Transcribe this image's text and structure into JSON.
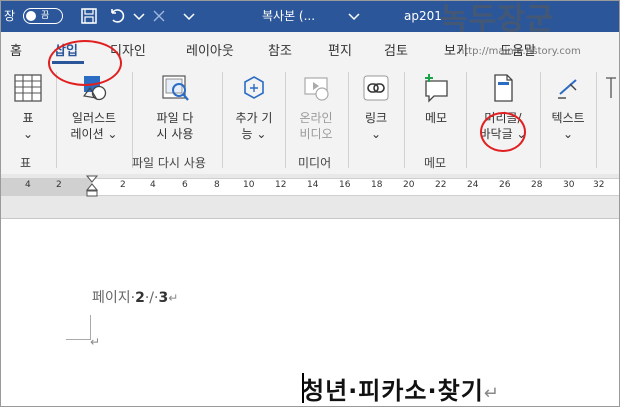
{
  "titlebar": {
    "save_prefix": "장",
    "autosave_label": "끔",
    "doc_title": "복사본 (...",
    "doc_suffix": "ap201"
  },
  "watermark": {
    "text": "녹두장군",
    "url": "http://mainia.tistory.com"
  },
  "tabs": [
    {
      "label": "홈"
    },
    {
      "label": "삽입",
      "active": true
    },
    {
      "label": "디자인"
    },
    {
      "label": "레이아웃"
    },
    {
      "label": "참조"
    },
    {
      "label": "편지"
    },
    {
      "label": "검토"
    },
    {
      "label": "보기"
    },
    {
      "label": "도움말"
    }
  ],
  "ribbon": {
    "table": {
      "line1": "표",
      "line2": "⌄",
      "group": "표"
    },
    "illustrations": {
      "line1": "일러스트",
      "line2": "레이션 ⌄"
    },
    "reuse": {
      "line1": "파일 다",
      "line2": "시 사용",
      "group": "파일 다시 사용"
    },
    "addins": {
      "line1": "추가 기",
      "line2": "능 ⌄"
    },
    "online_video": {
      "line1": "온라인",
      "line2": "비디오",
      "group": "미디어"
    },
    "link": {
      "line1": "링크",
      "line2": "⌄"
    },
    "comment": {
      "line1": "메모",
      "group": "메모"
    },
    "header_footer": {
      "line1": "머리글/",
      "line2": "바닥글 ⌄"
    },
    "text": {
      "line1": "텍스트",
      "line2": "⌄"
    }
  },
  "ruler": {
    "ticks": [
      "4",
      "2",
      "2",
      "4",
      "6",
      "8",
      "10",
      "12",
      "14",
      "16",
      "18",
      "20",
      "22",
      "24",
      "26",
      "28",
      "30",
      "32"
    ]
  },
  "document": {
    "pageinfo_label": "페이지·",
    "pageinfo_current": "2",
    "pageinfo_sep": "·/·",
    "pageinfo_total": "3",
    "paragraph_mark": "↵",
    "heading": "청년·피카소·찾기"
  },
  "colors": {
    "accent": "#2b579a",
    "annotation": "#e02020"
  }
}
